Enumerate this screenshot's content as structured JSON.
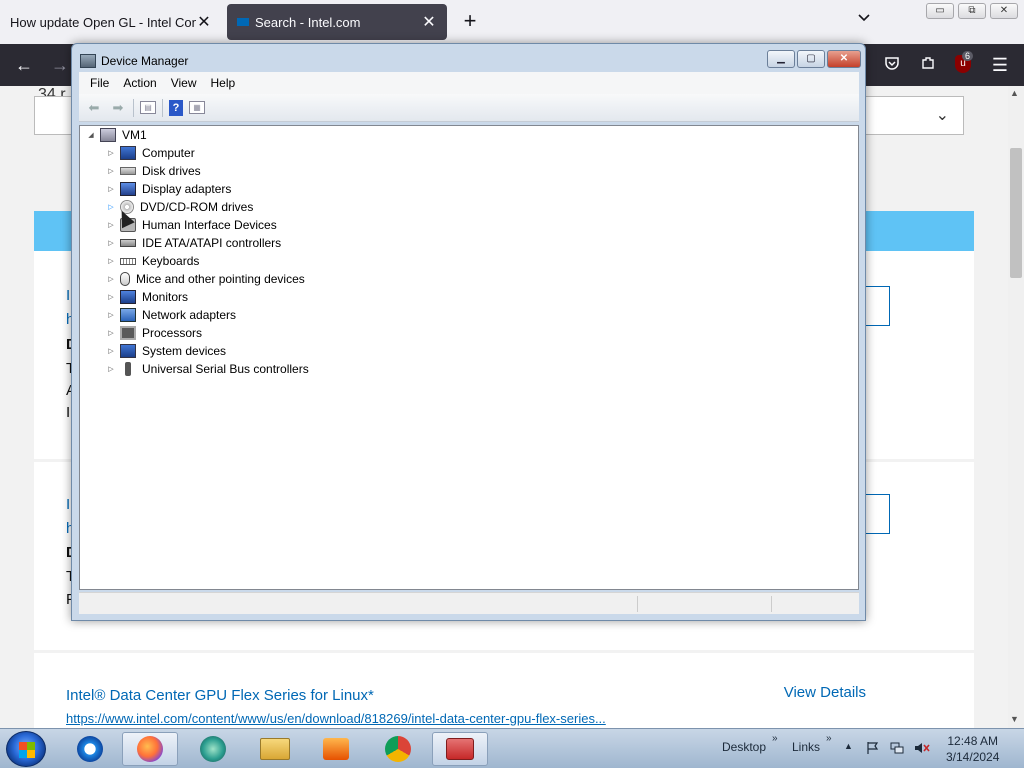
{
  "browser": {
    "tabs": [
      {
        "label": "How update Open GL - Intel Comm",
        "close": "✕"
      },
      {
        "label": "Search - Intel.com",
        "close": "✕"
      }
    ],
    "new_tab": "+",
    "tab_list": "⌄",
    "window_buttons": {
      "minimize": "▭",
      "restore": "⧉",
      "close": "✕"
    },
    "nav": {
      "back": "←",
      "forward": "→",
      "menu": "☰"
    },
    "extension_badge": "6"
  },
  "page": {
    "fragment_top": "34 r",
    "select_chevron": "⌄",
    "card1_lines": [
      "I",
      "h",
      "D",
      "T",
      "A",
      "I"
    ],
    "card2_lines": [
      "I",
      "h",
      "D",
      "T",
      "F"
    ],
    "card3": {
      "title": "Intel® Data Center GPU Flex Series for Linux*",
      "link": "https://www.intel.com/content/www/us/en/download/818269/intel-data-center-gpu-flex-series...",
      "view": "View Details"
    }
  },
  "device_manager": {
    "title": "Device Manager",
    "buttons": {
      "minimize": "▁",
      "maximize": "▢",
      "close": "✕"
    },
    "menu": [
      "File",
      "Action",
      "View",
      "Help"
    ],
    "toolbar": {
      "back": "⬅",
      "forward": "➡",
      "help": "?"
    },
    "tree": {
      "root": "VM1",
      "children": [
        {
          "label": "Computer",
          "icon": "computer"
        },
        {
          "label": "Disk drives",
          "icon": "disk"
        },
        {
          "label": "Display adapters",
          "icon": "display"
        },
        {
          "label": "DVD/CD-ROM drives",
          "icon": "dvd"
        },
        {
          "label": "Human Interface Devices",
          "icon": "hid"
        },
        {
          "label": "IDE ATA/ATAPI controllers",
          "icon": "ide"
        },
        {
          "label": "Keyboards",
          "icon": "kbd"
        },
        {
          "label": "Mice and other pointing devices",
          "icon": "mouse"
        },
        {
          "label": "Monitors",
          "icon": "monitor"
        },
        {
          "label": "Network adapters",
          "icon": "net"
        },
        {
          "label": "Processors",
          "icon": "cpu"
        },
        {
          "label": "System devices",
          "icon": "sys"
        },
        {
          "label": "Universal Serial Bus controllers",
          "icon": "usb"
        }
      ]
    }
  },
  "taskbar": {
    "desktop": "Desktop",
    "links": "Links",
    "more": "»",
    "time": "12:48 AM",
    "date": "3/14/2024"
  }
}
